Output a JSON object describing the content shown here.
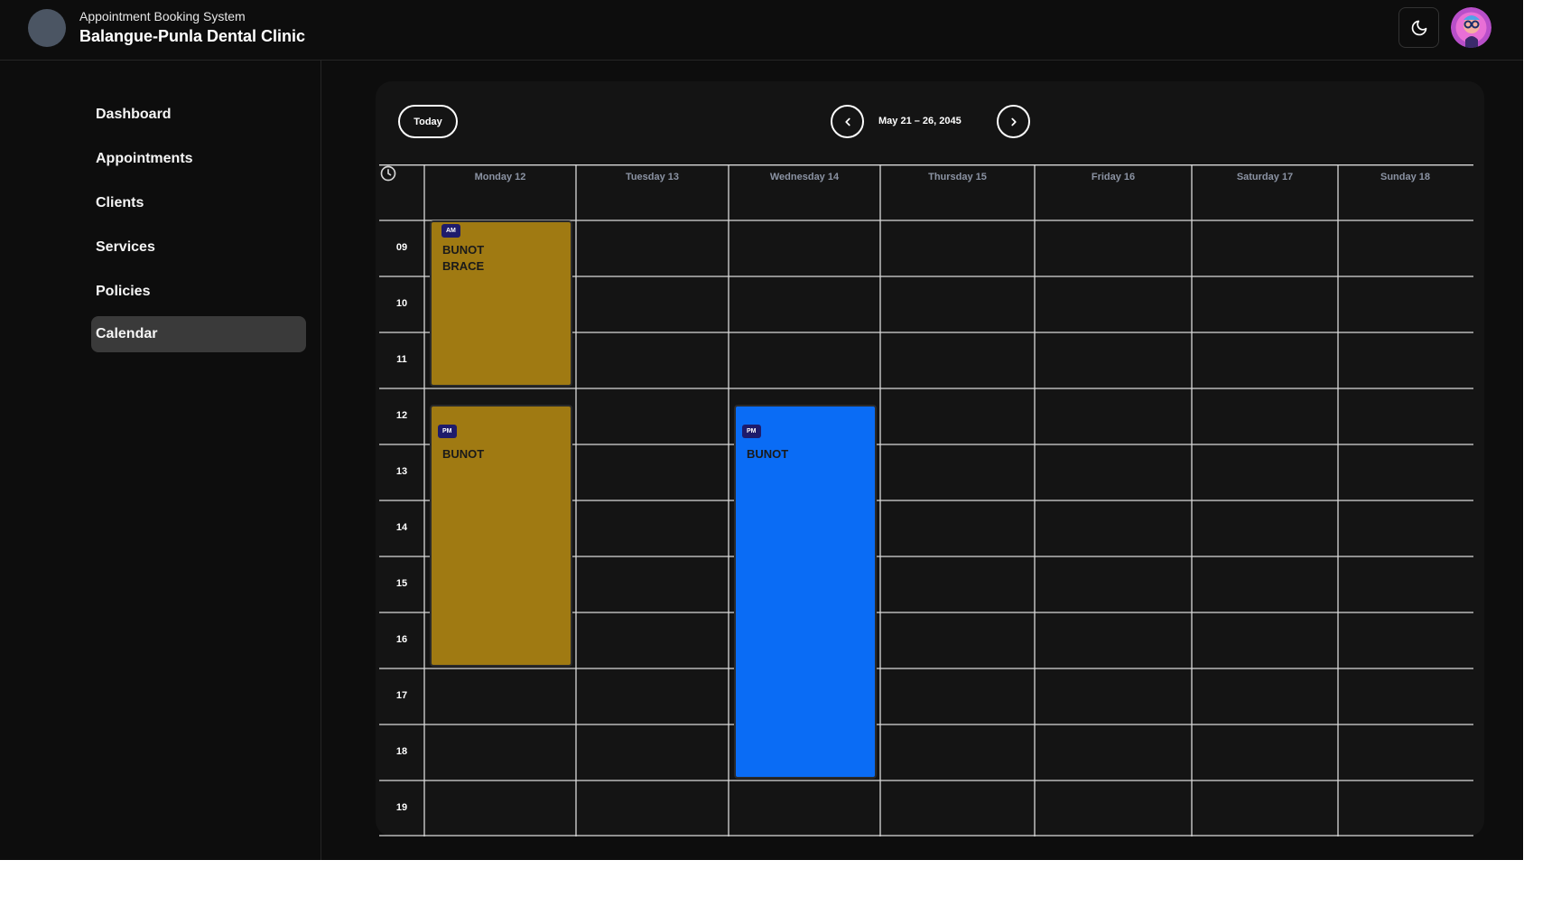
{
  "header": {
    "subtitle": "Appointment Booking System",
    "title": "Balangue-Punla Dental Clinic",
    "theme_icon": "moon-icon",
    "avatar_icon": "user-avatar"
  },
  "sidebar": {
    "items": [
      {
        "label": "Dashboard",
        "active": false
      },
      {
        "label": "Appointments",
        "active": false
      },
      {
        "label": "Clients",
        "active": false
      },
      {
        "label": "Services",
        "active": false
      },
      {
        "label": "Policies",
        "active": false
      },
      {
        "label": "Calendar",
        "active": true
      }
    ]
  },
  "calendar": {
    "today_label": "Today",
    "range_label": "May 21 – 26, 2045",
    "prev_icon": "chevron-left-icon",
    "next_icon": "chevron-right-icon",
    "days": [
      "Monday 12",
      "Tuesday 13",
      "Wednesday 14",
      "Thursday 15",
      "Friday 16",
      "Saturday 17",
      "Sunday 18"
    ],
    "hours": [
      "09",
      "10",
      "11",
      "12",
      "13",
      "14",
      "15",
      "16",
      "17",
      "18",
      "19"
    ],
    "events": [
      {
        "day": 0,
        "start": "09",
        "end": "11",
        "period": "AM",
        "title": "BUNOT\nBRACE",
        "color": "#a07a12"
      },
      {
        "day": 0,
        "start": "12",
        "end": "16",
        "period": "PM",
        "title": "BUNOT",
        "color": "#a07a12"
      },
      {
        "day": 2,
        "start": "12",
        "end": "18",
        "period": "PM",
        "title": "BUNOT",
        "color": "#0a6cf5"
      }
    ]
  },
  "colors": {
    "background": "#0d0d0d",
    "panel": "#141414",
    "active_nav": "#3a3a3a",
    "gold_event": "#a07a12",
    "blue_event": "#0a6cf5"
  }
}
